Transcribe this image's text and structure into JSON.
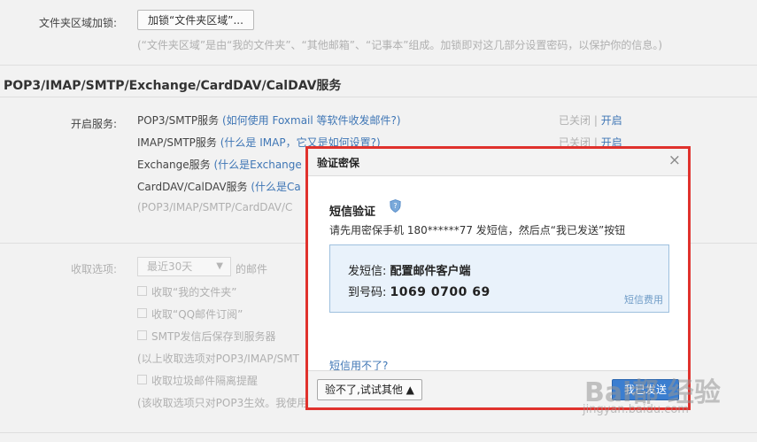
{
  "folder_lock": {
    "label": "文件夹区域加锁:",
    "button": "加锁“文件夹区域”...",
    "note": "(“文件夹区域”是由“我的文件夹”、“其他邮箱”、“记事本”组成。加锁即对这几部分设置密码，以保护你的信息。)"
  },
  "section": {
    "title": "POP3/IMAP/SMTP/Exchange/CardDAV/CalDAV服务"
  },
  "services": {
    "label": "开启服务:",
    "items": [
      {
        "name": "POP3/SMTP服务",
        "help": "(如何使用 Foxmail 等软件收发邮件?)",
        "status": "已关闭",
        "sep": "|",
        "action": "开启"
      },
      {
        "name": "IMAP/SMTP服务",
        "help": "(什么是 IMAP，它又是如何设置?)",
        "status": "已关闭",
        "sep": "|",
        "action": "开启"
      },
      {
        "name": "Exchange服务",
        "help": "(什么是Exchange"
      },
      {
        "name": "CardDAV/CalDAV服务",
        "help": "(什么是Ca"
      }
    ],
    "summary": "(POP3/IMAP/SMTP/CardDAV/C"
  },
  "receive": {
    "label": "收取选项:",
    "select_value": "最近30天",
    "suffix": "的邮件",
    "options": [
      "收取“我的文件夹”",
      "收取“QQ邮件订阅”",
      "SMTP发信后保存到服务器"
    ],
    "note1": "(以上收取选项对POP3/IMAP/SMT",
    "option4": "收取垃圾邮件隔离提醒",
    "note2": "(该收取选项只对POP3生效。我使用",
    "note2_link": ""
  },
  "dialog": {
    "title": "验证密保",
    "close": "×",
    "subtitle": "短信验证",
    "description": "请先用密保手机 180******77 发短信，然后点“我已发送”按钮",
    "sms_label": "发短信:",
    "sms_content": "配置邮件客户端",
    "to_label": "到号码:",
    "to_number": "1069 0700 69",
    "fee_link": "短信费用",
    "cant_use": "短信用不了?",
    "other_button": "验不了,试试其他 ▲",
    "sent_button": "我已发送"
  },
  "watermark": {
    "text": "Bai都 经验",
    "url": "jingyan.baidu.com"
  },
  "colors": {
    "accent": "#3b7ed0",
    "link": "#3f76b5",
    "highlight": "#e0322d",
    "info_bg": "#e9f2fb"
  }
}
